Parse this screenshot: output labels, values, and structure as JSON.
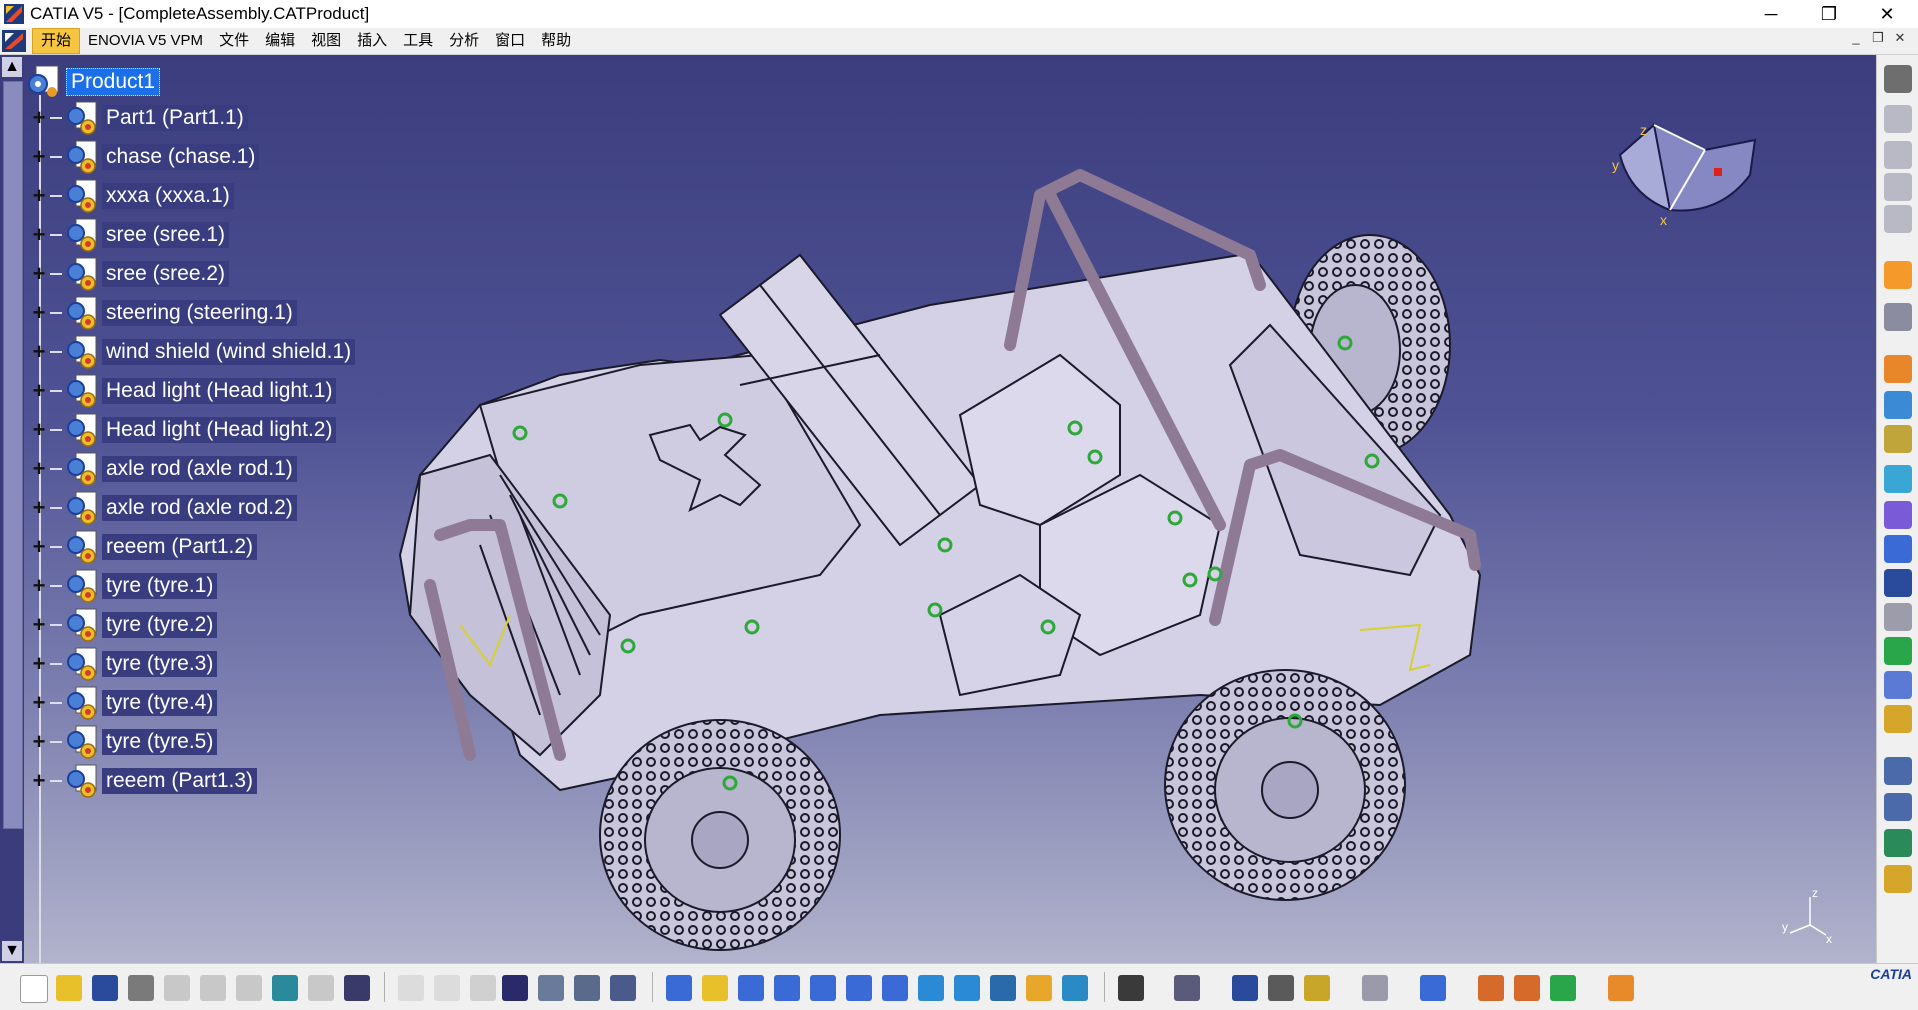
{
  "window": {
    "title": "CATIA V5 - [CompleteAssembly.CATProduct]",
    "controls": {
      "minimize": "─",
      "restore": "❐",
      "close": "✕"
    }
  },
  "menubar": {
    "items": [
      "开始",
      "ENOVIA V5 VPM",
      "文件",
      "编辑",
      "视图",
      "插入",
      "工具",
      "分析",
      "窗口",
      "帮助"
    ],
    "doc_controls": {
      "minimize": "_",
      "restore": "❐",
      "close": "✕"
    }
  },
  "tree": {
    "root": "Product1",
    "items": [
      "Part1 (Part1.1)",
      "chase (chase.1)",
      "xxxa (xxxa.1)",
      "sree (sree.1)",
      "sree (sree.2)",
      "steering (steering.1)",
      "wind shield (wind shield.1)",
      "Head light (Head light.1)",
      "Head light (Head light.2)",
      "axle rod (axle rod.1)",
      "axle rod (axle rod.2)",
      "reeem (Part1.2)",
      "tyre (tyre.1)",
      "tyre (tyre.2)",
      "tyre (tyre.3)",
      "tyre (tyre.4)",
      "tyre (tyre.5)",
      "reeem (Part1.3)"
    ],
    "expand_symbol": "+"
  },
  "scrollbar": {
    "up": "▲",
    "down": "▼"
  },
  "compass": {
    "x_label": "x",
    "y_label": "y",
    "z_label": "z"
  },
  "mini_axis": {
    "x_label": "x",
    "y_label": "y",
    "z_label": "z"
  },
  "brand": "CATIA",
  "colors": {
    "viewport_top": "#3b3d7e",
    "viewport_bottom": "#b2b3cc",
    "selection": "#1b6fe8",
    "menu_active": "#f5c542",
    "model_body": "#d4d1e6",
    "rollbar": "#8f7a95",
    "constraint": "#2fa83a"
  },
  "icons": {
    "tree_node": "product-gear-icon",
    "right_toolbar": [
      "assembly-gear-icon",
      "compass-icon",
      "sheet-icon",
      "sheet-icon",
      "sheet-icon",
      "select-arrow-icon",
      "move-icon",
      "gear-icon",
      "gear-icon",
      "gear-icon",
      "replace-icon",
      "snap-icon",
      "constraint-icon",
      "explode-icon",
      "text-icon",
      "layer-icon",
      "sheet-icon",
      "gear-icon",
      "analysis-icon",
      "analysis-icon",
      "fix-icon",
      "star-icon"
    ],
    "bottom_toolbar": [
      "new-icon",
      "open-icon",
      "save-icon",
      "print-icon",
      "cut-icon",
      "copy-icon",
      "paste-icon",
      "undo-icon",
      "redo-icon",
      "help-icon",
      "formula-icon",
      "comment-icon",
      "light-icon",
      "table-icon",
      "tree-icon",
      "catalog-icon",
      "list-icon",
      "fly-icon",
      "fit-all-icon",
      "pan-icon",
      "rotate-icon",
      "zoom-in-icon",
      "zoom-out-icon",
      "normal-view-icon",
      "iso-view-icon",
      "cube-view-icon",
      "render-icon",
      "hide-icon",
      "swap-icon",
      "camera-icon",
      "bom-icon",
      "measure-icon",
      "mass-icon",
      "weight-icon",
      "refresh-icon",
      "plane-icon",
      "sphere-icon",
      "sphere-icon",
      "tools-icon",
      "grid-icon"
    ]
  }
}
